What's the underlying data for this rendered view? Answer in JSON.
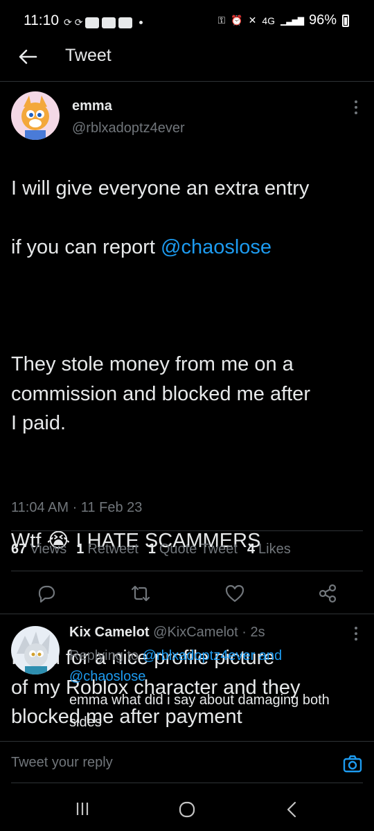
{
  "status_bar": {
    "time": "11:10",
    "battery": "96%",
    "network": "4G"
  },
  "header": {
    "title": "Tweet"
  },
  "tweet": {
    "author_name": "emma",
    "author_handle": "@rblxadoptz4ever",
    "line1": "I will give everyone an extra entry",
    "line2_pre": "if you can report ",
    "line2_mention": "@chaoslose",
    "para2": "They stole money from me on a\ncommission and blocked me after\nI paid.",
    "para3_pre": "Wtf ",
    "para3_emoji": "😭",
    "para3_post": " I HATE SCAMMERS",
    "para4": "I paid for a nice profile picture\nof my Roblox character and they\nblocked me after payment",
    "timestamp": "11:04 AM · 11 Feb 23"
  },
  "stats": {
    "views_count": "67",
    "views_label": "Views",
    "retweets_count": "1",
    "retweets_label": "Retweet",
    "quotes_count": "1",
    "quotes_label": "Quote Tweet",
    "likes_count": "4",
    "likes_label": "Likes"
  },
  "actions": [
    "reply-icon",
    "retweet-icon",
    "like-icon",
    "share-icon"
  ],
  "reply": {
    "author_name": "Kix Camelot",
    "author_handle": "@KixCamelot",
    "time": "· 2s",
    "replying_prefix": "Replying to ",
    "replying_handle1": "@rblxadoptz4ever",
    "replying_and": " and",
    "replying_handle2": "@chaoslose",
    "text": "emma what did i say about damaging both sides"
  },
  "composer": {
    "placeholder": "Tweet your reply"
  },
  "colors": {
    "accent": "#1d9bf0",
    "background": "#000000",
    "muted": "#71767b",
    "divider": "#2f3336"
  }
}
